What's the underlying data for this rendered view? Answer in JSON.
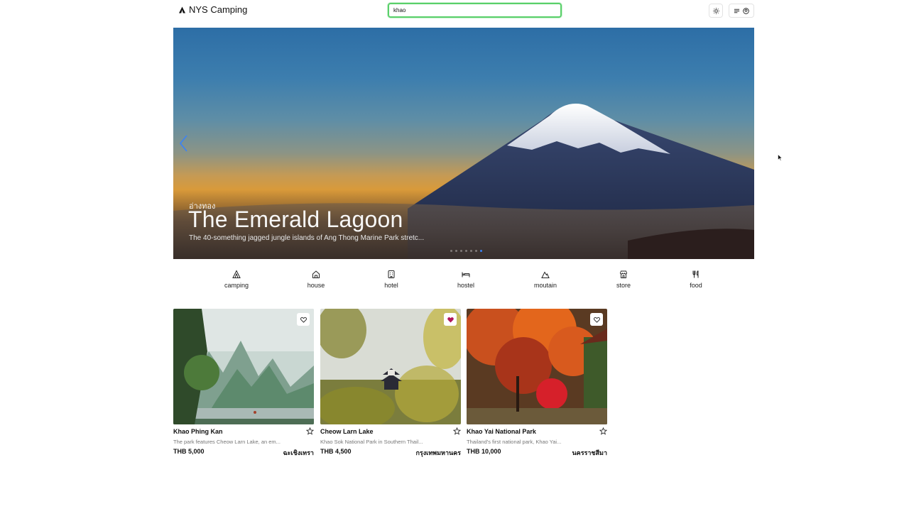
{
  "header": {
    "brand": "NYS Camping",
    "search_value": "khao",
    "theme_icon": "sun-icon",
    "menu_icons": [
      "menu-icon",
      "user-circle-icon"
    ]
  },
  "hero": {
    "subtitle": "อ่างทอง",
    "title": "The Emerald Lagoon",
    "description": "The 40-something jagged jungle islands of Ang Thong Marine Park stretc...",
    "slide_count": 7,
    "active_slide_index": 6,
    "accent": "#3b82f6"
  },
  "categories": [
    {
      "label": "camping",
      "icon": "tent-icon"
    },
    {
      "label": "house",
      "icon": "house-icon"
    },
    {
      "label": "hotel",
      "icon": "hotel-icon"
    },
    {
      "label": "hostel",
      "icon": "bed-icon"
    },
    {
      "label": "moutain",
      "icon": "mountain-icon"
    },
    {
      "label": "store",
      "icon": "store-icon"
    },
    {
      "label": "food",
      "icon": "utensils-icon"
    }
  ],
  "listings": [
    {
      "name": "Khao Phing Kan",
      "description": "The park features Cheow Larn Lake, an em...",
      "price": "THB 5,000",
      "location": "ฉะเชิงเทรา",
      "favorited": false
    },
    {
      "name": "Cheow Larn Lake",
      "description": "Khao Sok National Park in Southern Thail...",
      "price": "THB 4,500",
      "location": "กรุงเทพมหานคร",
      "favorited": true
    },
    {
      "name": "Khao Yai National Park",
      "description": "Thailand's first national park, Khao Yai...",
      "price": "THB 10,000",
      "location": "นครราชสีมา",
      "favorited": false
    }
  ],
  "colors": {
    "favorite_active": "#b0155a",
    "search_focus": "#5ad06a"
  }
}
